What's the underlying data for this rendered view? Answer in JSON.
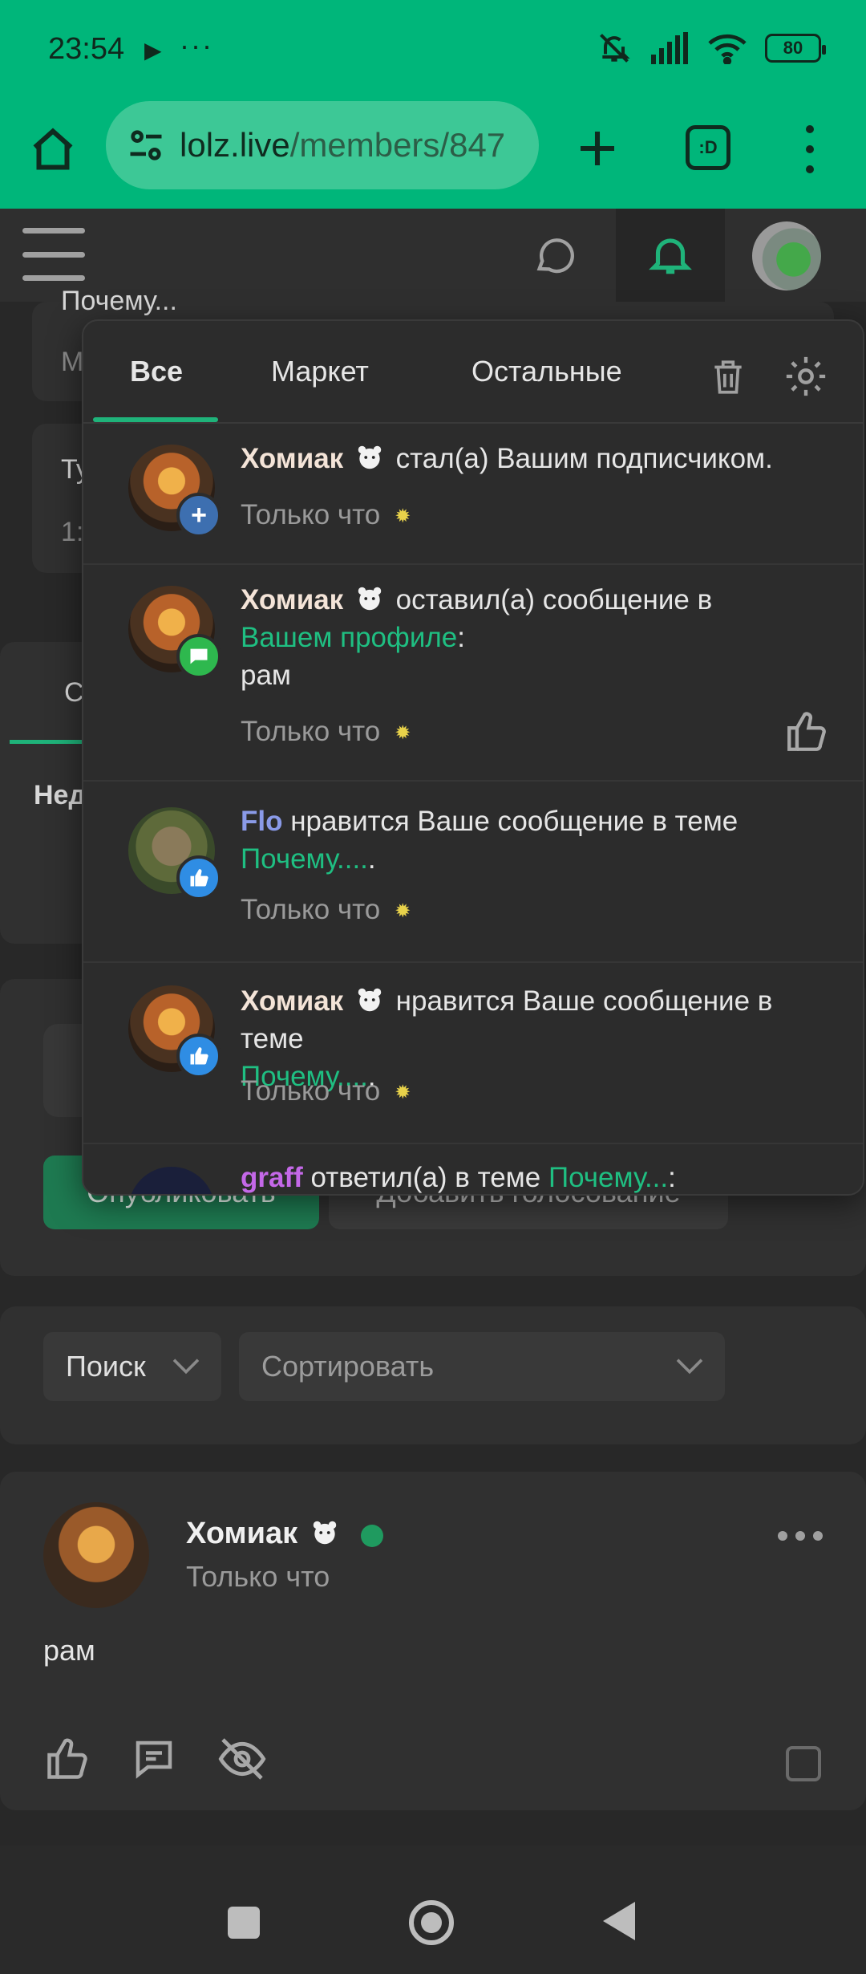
{
  "status_bar": {
    "time": "23:54",
    "play_icon": "▶",
    "dots": "···",
    "battery": "80"
  },
  "browser": {
    "url_host": "lolz.live",
    "url_path": "/members/847",
    "tabs_label": ":D"
  },
  "background": {
    "card1_title": "Почему...",
    "card1_sub": "М",
    "card2_title": "Ту",
    "card2_sub": "1:",
    "tab_partial": "С",
    "section_partial": "Нед",
    "publish_button": "Опубликовать",
    "poll_button": "Добавить голосование",
    "search_label": "Поиск",
    "sort_label": "Сортировать"
  },
  "post": {
    "author": "Хомиак",
    "time": "Только что",
    "body": "рам"
  },
  "notifications": {
    "tabs": [
      "Все",
      "Маркет",
      "Остальные"
    ],
    "items": [
      {
        "user": "Хомиак",
        "action": "стал(а) Вашим подписчиком.",
        "link": "",
        "after_link": "",
        "extra": "",
        "time": "Только что",
        "badge": "+"
      },
      {
        "user": "Хомиак",
        "action": "оставил(а) сообщение в",
        "link": "Вашем профиле",
        "after_link": ":",
        "extra": "рам",
        "time": "Только что",
        "badge": "💬"
      },
      {
        "user": "Flo",
        "action": "нравится Ваше сообщение в теме",
        "link": "Почему....",
        "after_link": ".",
        "extra": "",
        "time": "Только что",
        "badge": "👍"
      },
      {
        "user": "Хомиак",
        "action": "нравится Ваше сообщение в теме",
        "link": "Почему....",
        "after_link": ".",
        "extra": "",
        "time": "Только что",
        "badge": "👍"
      },
      {
        "user": "graff",
        "action": "ответил(а) в теме",
        "link": "Почему...",
        "after_link": ":",
        "extra": "",
        "time": "",
        "badge": ""
      }
    ]
  },
  "colors": {
    "accent": "#00b67a",
    "link": "#1fbf82",
    "bg": "#282828"
  }
}
